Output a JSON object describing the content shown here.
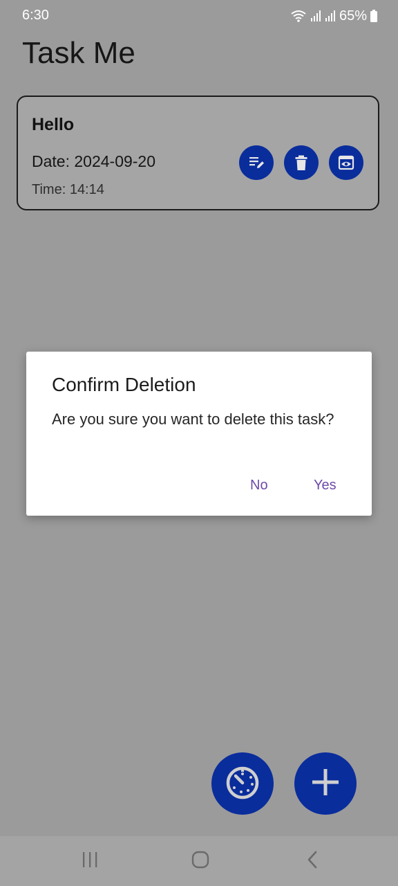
{
  "status_bar": {
    "time": "6:30",
    "battery_percent": "65%",
    "icons": [
      "wifi-icon",
      "signal-icon",
      "signal-icon",
      "battery-icon"
    ]
  },
  "app": {
    "title": "Task Me"
  },
  "task": {
    "title": "Hello",
    "date": "Date: 2024-09-20",
    "time": "Time: 14:14",
    "actions": [
      "edit-icon",
      "delete-icon",
      "view-icon"
    ]
  },
  "dialog": {
    "title": "Confirm Deletion",
    "message": "Are you sure you want to delete this task?",
    "no_label": "No",
    "yes_label": "Yes"
  },
  "fabs": [
    "timer-icon",
    "add-icon"
  ],
  "nav": [
    "recents-icon",
    "home-icon",
    "back-icon"
  ],
  "colors": {
    "accent": "#0a2d9c",
    "dialog_button": "#6d4aa8",
    "scrim_background": "#9b9b9b"
  }
}
